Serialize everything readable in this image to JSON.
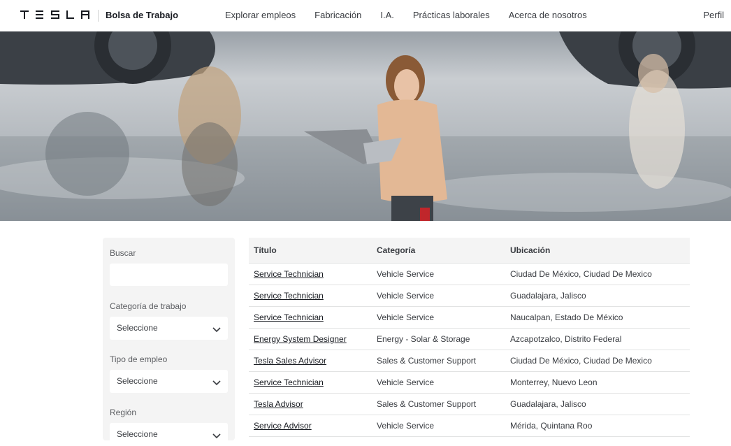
{
  "header": {
    "logo_text": "TESLA",
    "brand": "Bolsa de Trabajo",
    "nav": [
      "Explorar empleos",
      "Fabricación",
      "I.A.",
      "Prácticas laborales",
      "Acerca de nosotros"
    ],
    "profile": "Perfil"
  },
  "filters": {
    "search_label": "Buscar",
    "search_value": "",
    "category_label": "Categoría de trabajo",
    "category_value": "Seleccione",
    "type_label": "Tipo de empleo",
    "type_value": "Seleccione",
    "region_label": "Región",
    "region_value": "Seleccione"
  },
  "table": {
    "headers": [
      "Título",
      "Categoría",
      "Ubicación"
    ],
    "rows": [
      [
        "Service Technician",
        "Vehicle Service",
        "Ciudad De México, Ciudad De Mexico"
      ],
      [
        "Service Technician",
        "Vehicle Service",
        "Guadalajara, Jalisco"
      ],
      [
        "Service Technician",
        "Vehicle Service",
        "Naucalpan, Estado De México"
      ],
      [
        "Energy System Designer",
        "Energy - Solar & Storage",
        "Azcapotzalco, Distrito Federal"
      ],
      [
        "Tesla Sales Advisor",
        "Sales & Customer Support",
        "Ciudad De México, Ciudad De Mexico"
      ],
      [
        "Service Technician",
        "Vehicle Service",
        "Monterrey, Nuevo Leon"
      ],
      [
        "Tesla Advisor",
        "Sales & Customer Support",
        "Guadalajara, Jalisco"
      ],
      [
        "Service Advisor",
        "Vehicle Service",
        "Mérida, Quintana Roo"
      ]
    ]
  }
}
